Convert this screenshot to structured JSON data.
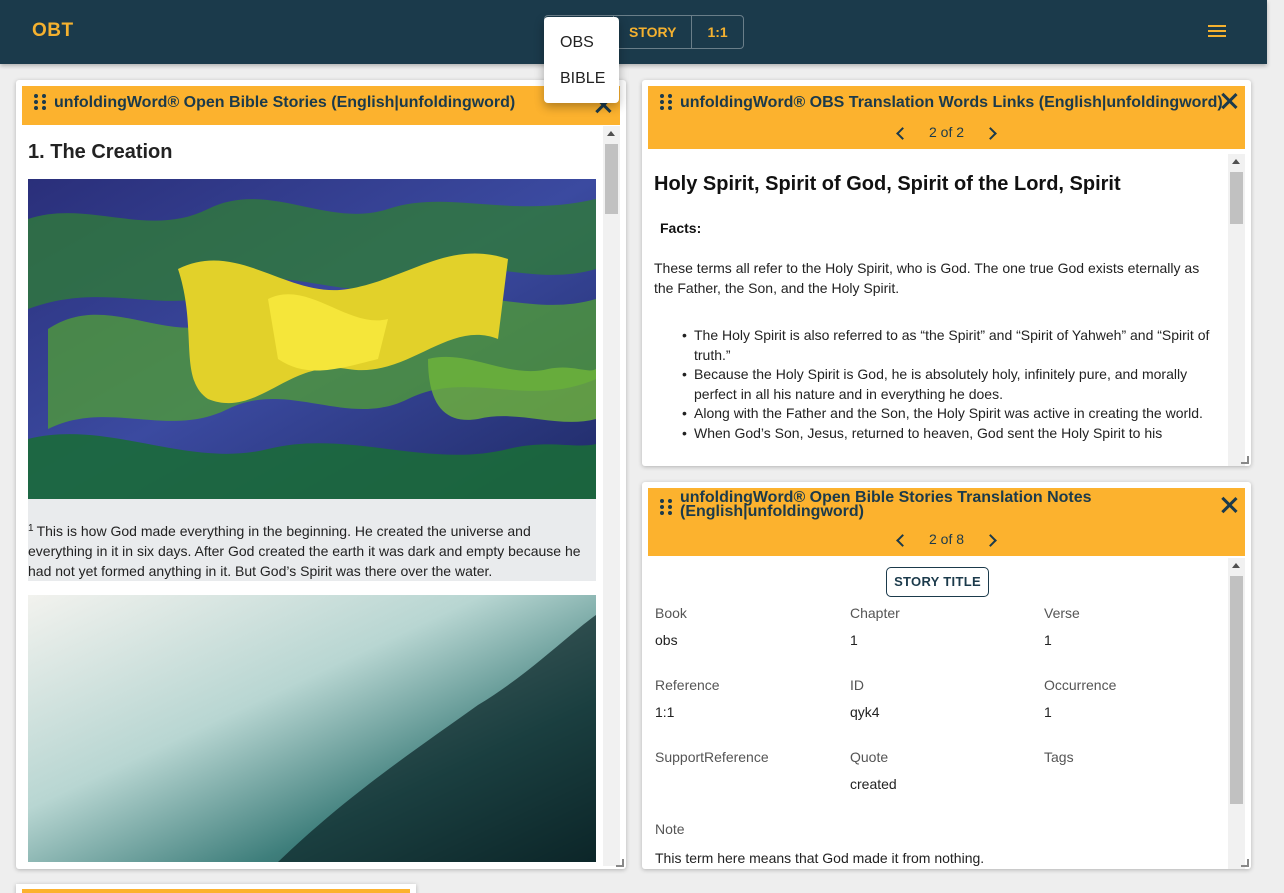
{
  "app": {
    "title": "OBT"
  },
  "toolbar": {
    "toggle": [
      "STORY",
      "1:1"
    ],
    "dropdown": [
      "OBS",
      "BIBLE"
    ]
  },
  "story_card": {
    "title": "unfoldingWord® Open Bible Stories (English|unfoldingword)",
    "heading": "1. The Creation",
    "frame": {
      "number": "1",
      "text": "This is how God made everything in the beginning. He created the universe and everything in it in six days. After God created the earth it was dark and empty because he had not yet formed anything in it. But God’s Spirit was there over the water."
    }
  },
  "tw_card": {
    "title": "unfoldingWord® OBS Translation Words Links (English|unfoldingword)",
    "pager": "2 of 2",
    "article_title": "Holy Spirit, Spirit of God, Spirit of the Lord, Spirit",
    "facts_label": "Facts:",
    "paragraph": "These terms all refer to the Holy Spirit, who is God. The one true God exists eternally as the Father, the Son, and the Holy Spirit.",
    "bullets": [
      "The Holy Spirit is also referred to as “the Spirit” and “Spirit of Yahweh” and “Spirit of truth.”",
      "Because the Holy Spirit is God, he is absolutely holy, infinitely pure, and morally perfect in all his nature and in everything he does.",
      "Along with the Father and the Son, the Holy Spirit was active in creating the world.",
      "When God’s Son, Jesus, returned to heaven, God sent the Holy Spirit to his"
    ]
  },
  "tn_card": {
    "title_line1": "unfoldingWord® Open Bible Stories Translation Notes",
    "title_line2": "(English|unfoldingword)",
    "pager": "2 of 8",
    "story_title_button": "STORY TITLE",
    "fields": {
      "book_label": "Book",
      "book": "obs",
      "chapter_label": "Chapter",
      "chapter": "1",
      "verse_label": "Verse",
      "verse": "1",
      "reference_label": "Reference",
      "reference": "1:1",
      "id_label": "ID",
      "id": "qyk4",
      "occurrence_label": "Occurrence",
      "occurrence": "1",
      "support_label": "SupportReference",
      "support": "",
      "quote_label": "Quote",
      "quote": "created",
      "tags_label": "Tags",
      "tags": "",
      "note_label": "Note",
      "note": "This term here means that God made it from nothing."
    }
  },
  "colors": {
    "appbar": "#1b3a4b",
    "accent": "#fcb22e",
    "brand_text": "#f5b12f"
  }
}
